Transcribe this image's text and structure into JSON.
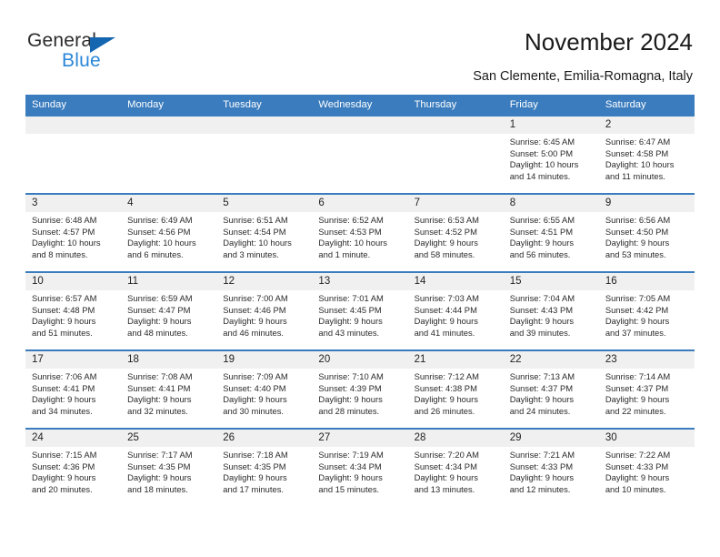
{
  "brand": {
    "name_top": "General",
    "name_bottom": "Blue",
    "triangle_color": "#1566b0",
    "blue_color": "#2a87d8"
  },
  "header": {
    "title": "November 2024",
    "subtitle": "San Clemente, Emilia-Romagna, Italy"
  },
  "theme": {
    "header_blue": "#3a7cbe",
    "daynum_band": "#f0f0f0",
    "cell_bg": "#ffffff"
  },
  "weekday_headers": [
    "Sunday",
    "Monday",
    "Tuesday",
    "Wednesday",
    "Thursday",
    "Friday",
    "Saturday"
  ],
  "labels": {
    "sunrise_prefix": "Sunrise: ",
    "sunset_prefix": "Sunset: ",
    "daylight_prefix": "Daylight: "
  },
  "weeks": [
    [
      {
        "empty": true
      },
      {
        "empty": true
      },
      {
        "empty": true
      },
      {
        "empty": true
      },
      {
        "empty": true
      },
      {
        "day": "1",
        "sunrise": "Sunrise: 6:45 AM",
        "sunset": "Sunset: 5:00 PM",
        "daylight_line1": "Daylight: 10 hours",
        "daylight_line2": "and 14 minutes."
      },
      {
        "day": "2",
        "sunrise": "Sunrise: 6:47 AM",
        "sunset": "Sunset: 4:58 PM",
        "daylight_line1": "Daylight: 10 hours",
        "daylight_line2": "and 11 minutes."
      }
    ],
    [
      {
        "day": "3",
        "sunrise": "Sunrise: 6:48 AM",
        "sunset": "Sunset: 4:57 PM",
        "daylight_line1": "Daylight: 10 hours",
        "daylight_line2": "and 8 minutes."
      },
      {
        "day": "4",
        "sunrise": "Sunrise: 6:49 AM",
        "sunset": "Sunset: 4:56 PM",
        "daylight_line1": "Daylight: 10 hours",
        "daylight_line2": "and 6 minutes."
      },
      {
        "day": "5",
        "sunrise": "Sunrise: 6:51 AM",
        "sunset": "Sunset: 4:54 PM",
        "daylight_line1": "Daylight: 10 hours",
        "daylight_line2": "and 3 minutes."
      },
      {
        "day": "6",
        "sunrise": "Sunrise: 6:52 AM",
        "sunset": "Sunset: 4:53 PM",
        "daylight_line1": "Daylight: 10 hours",
        "daylight_line2": "and 1 minute."
      },
      {
        "day": "7",
        "sunrise": "Sunrise: 6:53 AM",
        "sunset": "Sunset: 4:52 PM",
        "daylight_line1": "Daylight: 9 hours",
        "daylight_line2": "and 58 minutes."
      },
      {
        "day": "8",
        "sunrise": "Sunrise: 6:55 AM",
        "sunset": "Sunset: 4:51 PM",
        "daylight_line1": "Daylight: 9 hours",
        "daylight_line2": "and 56 minutes."
      },
      {
        "day": "9",
        "sunrise": "Sunrise: 6:56 AM",
        "sunset": "Sunset: 4:50 PM",
        "daylight_line1": "Daylight: 9 hours",
        "daylight_line2": "and 53 minutes."
      }
    ],
    [
      {
        "day": "10",
        "sunrise": "Sunrise: 6:57 AM",
        "sunset": "Sunset: 4:48 PM",
        "daylight_line1": "Daylight: 9 hours",
        "daylight_line2": "and 51 minutes."
      },
      {
        "day": "11",
        "sunrise": "Sunrise: 6:59 AM",
        "sunset": "Sunset: 4:47 PM",
        "daylight_line1": "Daylight: 9 hours",
        "daylight_line2": "and 48 minutes."
      },
      {
        "day": "12",
        "sunrise": "Sunrise: 7:00 AM",
        "sunset": "Sunset: 4:46 PM",
        "daylight_line1": "Daylight: 9 hours",
        "daylight_line2": "and 46 minutes."
      },
      {
        "day": "13",
        "sunrise": "Sunrise: 7:01 AM",
        "sunset": "Sunset: 4:45 PM",
        "daylight_line1": "Daylight: 9 hours",
        "daylight_line2": "and 43 minutes."
      },
      {
        "day": "14",
        "sunrise": "Sunrise: 7:03 AM",
        "sunset": "Sunset: 4:44 PM",
        "daylight_line1": "Daylight: 9 hours",
        "daylight_line2": "and 41 minutes."
      },
      {
        "day": "15",
        "sunrise": "Sunrise: 7:04 AM",
        "sunset": "Sunset: 4:43 PM",
        "daylight_line1": "Daylight: 9 hours",
        "daylight_line2": "and 39 minutes."
      },
      {
        "day": "16",
        "sunrise": "Sunrise: 7:05 AM",
        "sunset": "Sunset: 4:42 PM",
        "daylight_line1": "Daylight: 9 hours",
        "daylight_line2": "and 37 minutes."
      }
    ],
    [
      {
        "day": "17",
        "sunrise": "Sunrise: 7:06 AM",
        "sunset": "Sunset: 4:41 PM",
        "daylight_line1": "Daylight: 9 hours",
        "daylight_line2": "and 34 minutes."
      },
      {
        "day": "18",
        "sunrise": "Sunrise: 7:08 AM",
        "sunset": "Sunset: 4:41 PM",
        "daylight_line1": "Daylight: 9 hours",
        "daylight_line2": "and 32 minutes."
      },
      {
        "day": "19",
        "sunrise": "Sunrise: 7:09 AM",
        "sunset": "Sunset: 4:40 PM",
        "daylight_line1": "Daylight: 9 hours",
        "daylight_line2": "and 30 minutes."
      },
      {
        "day": "20",
        "sunrise": "Sunrise: 7:10 AM",
        "sunset": "Sunset: 4:39 PM",
        "daylight_line1": "Daylight: 9 hours",
        "daylight_line2": "and 28 minutes."
      },
      {
        "day": "21",
        "sunrise": "Sunrise: 7:12 AM",
        "sunset": "Sunset: 4:38 PM",
        "daylight_line1": "Daylight: 9 hours",
        "daylight_line2": "and 26 minutes."
      },
      {
        "day": "22",
        "sunrise": "Sunrise: 7:13 AM",
        "sunset": "Sunset: 4:37 PM",
        "daylight_line1": "Daylight: 9 hours",
        "daylight_line2": "and 24 minutes."
      },
      {
        "day": "23",
        "sunrise": "Sunrise: 7:14 AM",
        "sunset": "Sunset: 4:37 PM",
        "daylight_line1": "Daylight: 9 hours",
        "daylight_line2": "and 22 minutes."
      }
    ],
    [
      {
        "day": "24",
        "sunrise": "Sunrise: 7:15 AM",
        "sunset": "Sunset: 4:36 PM",
        "daylight_line1": "Daylight: 9 hours",
        "daylight_line2": "and 20 minutes."
      },
      {
        "day": "25",
        "sunrise": "Sunrise: 7:17 AM",
        "sunset": "Sunset: 4:35 PM",
        "daylight_line1": "Daylight: 9 hours",
        "daylight_line2": "and 18 minutes."
      },
      {
        "day": "26",
        "sunrise": "Sunrise: 7:18 AM",
        "sunset": "Sunset: 4:35 PM",
        "daylight_line1": "Daylight: 9 hours",
        "daylight_line2": "and 17 minutes."
      },
      {
        "day": "27",
        "sunrise": "Sunrise: 7:19 AM",
        "sunset": "Sunset: 4:34 PM",
        "daylight_line1": "Daylight: 9 hours",
        "daylight_line2": "and 15 minutes."
      },
      {
        "day": "28",
        "sunrise": "Sunrise: 7:20 AM",
        "sunset": "Sunset: 4:34 PM",
        "daylight_line1": "Daylight: 9 hours",
        "daylight_line2": "and 13 minutes."
      },
      {
        "day": "29",
        "sunrise": "Sunrise: 7:21 AM",
        "sunset": "Sunset: 4:33 PM",
        "daylight_line1": "Daylight: 9 hours",
        "daylight_line2": "and 12 minutes."
      },
      {
        "day": "30",
        "sunrise": "Sunrise: 7:22 AM",
        "sunset": "Sunset: 4:33 PM",
        "daylight_line1": "Daylight: 9 hours",
        "daylight_line2": "and 10 minutes."
      }
    ]
  ]
}
